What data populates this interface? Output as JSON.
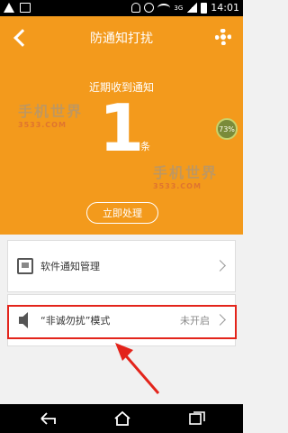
{
  "status_bar": {
    "network": "3G",
    "time": "14:01",
    "icons": [
      "warning-icon",
      "image-icon",
      "mute-icon",
      "alarm-icon",
      "wifi-icon",
      "signal-icon",
      "battery-icon"
    ]
  },
  "header": {
    "title": "防通知打扰",
    "back_icon": "back-icon",
    "settings_icon": "gear-icon",
    "background_color": "#f39a1c"
  },
  "summary": {
    "label": "近期收到通知",
    "count": "1",
    "unit": "条",
    "badge": "73%",
    "action_label": "立即处理"
  },
  "list": [
    {
      "label": "软件通知管理",
      "icon": "phone-icon"
    },
    {
      "label": "“非诚勿扰”模式",
      "icon": "speaker-icon",
      "status": "未开启"
    }
  ],
  "watermark": {
    "main": "手机世界",
    "sub": "3533.COM"
  },
  "annotation": {
    "color": "#e3241b"
  },
  "nav_bar": {
    "icons": [
      "back-nav-icon",
      "home-nav-icon",
      "recent-apps-icon"
    ]
  }
}
